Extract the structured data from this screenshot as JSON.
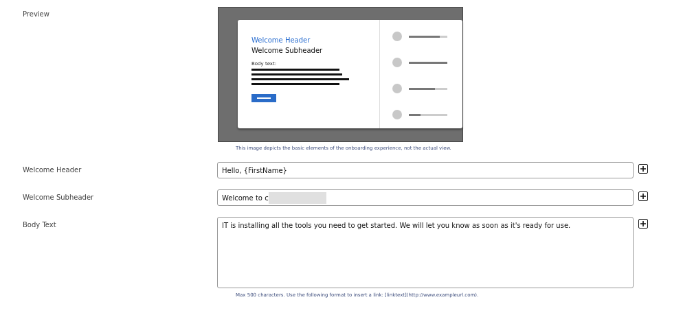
{
  "preview": {
    "label": "Preview",
    "header": "Welcome Header",
    "subheader": "Welcome Subheader",
    "body_label": "Body text:",
    "progress_items": [
      {
        "level": 0.8
      },
      {
        "level": 1.0
      },
      {
        "level": 0.67
      },
      {
        "level": 0.3
      }
    ],
    "caption": "This image depicts the basic elements of the onboarding experience, not the actual view."
  },
  "fields": [
    {
      "kind": "input",
      "label": "Welcome Header",
      "value": "Hello, {FirstName}",
      "redacted": false
    },
    {
      "kind": "input",
      "label": "Welcome Subheader",
      "value": "Welcome to c",
      "redacted": true
    },
    {
      "kind": "textarea",
      "label": "Body Text",
      "value": "IT is installing all the tools you need to get started. We will let you know as soon as it's ready for use.",
      "redacted": false,
      "hint": "Max 500 characters. Use the following format to insert a link: [linktext](http://www.exampleurl.com)."
    }
  ]
}
